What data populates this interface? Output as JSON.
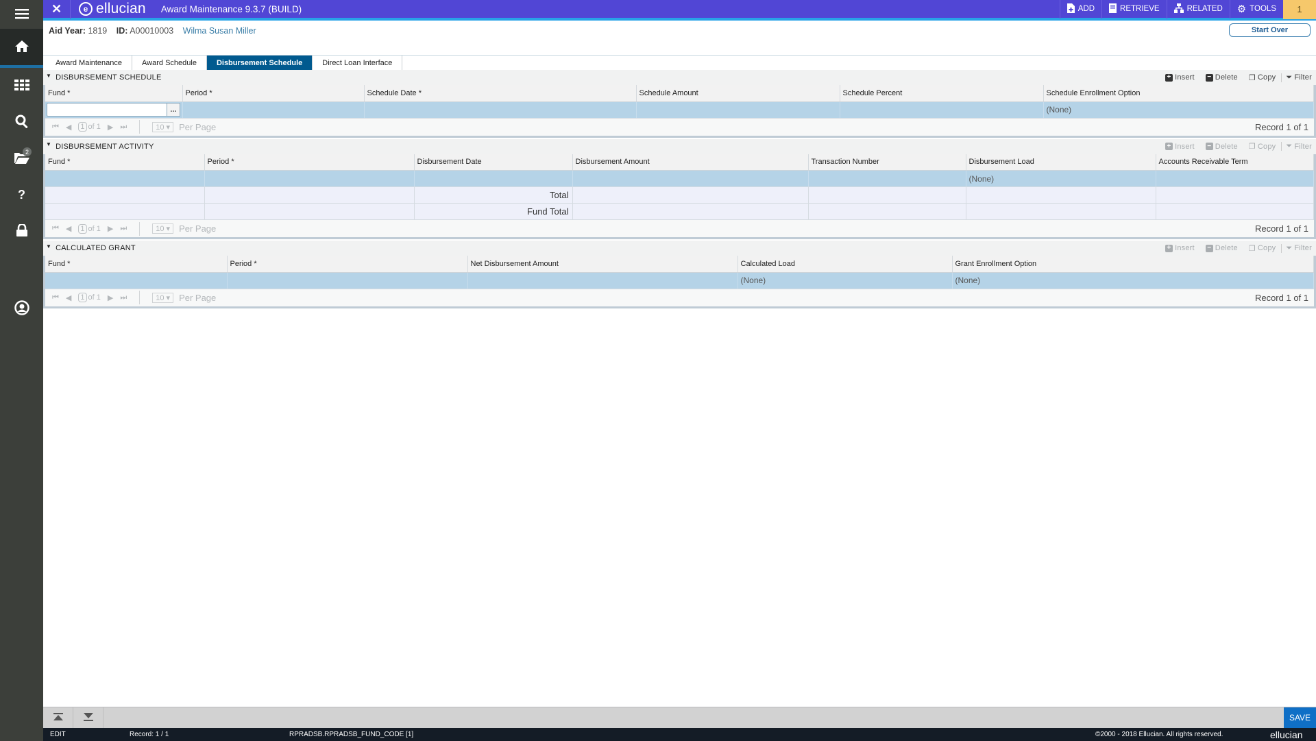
{
  "app": {
    "brand": "ellucian",
    "title": "Award Maintenance 9.3.7 (BUILD)",
    "close_label": "✕"
  },
  "sidebar": {
    "items": [
      {
        "name": "menu",
        "icon": "hamburger-icon"
      },
      {
        "name": "home",
        "icon": "home-icon"
      },
      {
        "name": "applications",
        "icon": "grid-icon"
      },
      {
        "name": "search",
        "icon": "search-icon"
      },
      {
        "name": "recent",
        "icon": "folder-open-icon",
        "badge": "2"
      },
      {
        "name": "help",
        "icon": "question-icon"
      },
      {
        "name": "lock",
        "icon": "lock-icon"
      },
      {
        "name": "user",
        "icon": "user-circle-icon"
      }
    ]
  },
  "toolbar": {
    "add": "ADD",
    "retrieve": "RETRIEVE",
    "related": "RELATED",
    "tools": "TOOLS",
    "notifications": "1"
  },
  "key_block": {
    "aid_year_label": "Aid Year:",
    "aid_year": "1819",
    "id_label": "ID:",
    "id": "A00010003",
    "name": "Wilma Susan  Miller",
    "start_over": "Start Over"
  },
  "tabs": [
    {
      "label": "Award Maintenance",
      "active": false
    },
    {
      "label": "Award Schedule",
      "active": false
    },
    {
      "label": "Disbursement Schedule",
      "active": true
    },
    {
      "label": "Direct Loan Interface",
      "active": false
    }
  ],
  "section_tools": {
    "insert": "Insert",
    "delete": "Delete",
    "copy": "Copy",
    "filter": "Filter"
  },
  "pager": {
    "page": "1",
    "of": "of 1",
    "per_page_value": "10",
    "per_page_label": "Per Page",
    "record": "Record 1 of 1"
  },
  "disbursement_schedule": {
    "title": "DISBURSEMENT SCHEDULE",
    "columns": [
      "Fund *",
      "Period *",
      "Schedule Date *",
      "Schedule Amount",
      "Schedule Percent",
      "Schedule Enrollment Option"
    ],
    "row": {
      "fund": "",
      "period": "",
      "schedule_date": "",
      "schedule_amount": "",
      "schedule_percent": "",
      "enrollment_option": "(None)"
    },
    "lookup_label": "..."
  },
  "disbursement_activity": {
    "title": "DISBURSEMENT ACTIVITY",
    "columns": [
      "Fund *",
      "Period *",
      "Disbursement Date",
      "Disbursement Amount",
      "Transaction Number",
      "Disbursement Load",
      "Accounts Receivable Term"
    ],
    "row": {
      "fund": "",
      "period": "",
      "date": "",
      "amount": "",
      "transaction": "",
      "load": "(None)",
      "ar_term": ""
    },
    "total_label": "Total",
    "fund_total_label": "Fund Total"
  },
  "calculated_grant": {
    "title": "CALCULATED GRANT",
    "columns": [
      "Fund *",
      "Period *",
      "Net Disbursement Amount",
      "Calculated Load",
      "Grant Enrollment Option"
    ],
    "row": {
      "fund": "",
      "period": "",
      "net_amount": "",
      "calculated_load": "(None)",
      "enrollment_option": "(None)"
    }
  },
  "footer": {
    "save": "SAVE",
    "mode": "EDIT",
    "record": "Record: 1 / 1",
    "field": "RPRADSB.RPRADSB_FUND_CODE [1]",
    "copyright": "©2000 - 2018 Ellucian. All rights reserved.",
    "brand": "ellucian"
  }
}
